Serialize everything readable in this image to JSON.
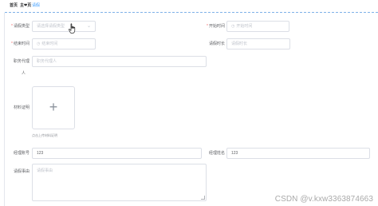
{
  "breadcrumb": {
    "home": "首页",
    "current": "主❤页",
    "active_tab": "请假"
  },
  "form": {
    "leave_type": {
      "label": "请假类型",
      "placeholder": "请选择请假类型"
    },
    "start_time": {
      "label": "开始时间",
      "placeholder": "开始时间"
    },
    "end_time": {
      "label": "结束时间",
      "placeholder": "结束时间"
    },
    "leave_duration": {
      "label": "请假时长",
      "placeholder": "请假时长"
    },
    "delegate": {
      "label": "职务代理",
      "label_wrap": "人",
      "placeholder": "职务代理人"
    },
    "material": {
      "label": "材料证明",
      "tip": "点击上传材料证明"
    },
    "manager_account": {
      "label": "经理账号",
      "value": "123"
    },
    "manager_name": {
      "label": "经理姓名",
      "value": "123"
    },
    "reason": {
      "label": "请假事由",
      "placeholder": "请假事由"
    }
  },
  "icons": {
    "clock": "clock-icon",
    "chevron": "chevron-down-icon",
    "plus": "plus-icon",
    "cursor": "hand-pointer-icon"
  },
  "colors": {
    "required": "#f56c6c",
    "accent": "#409eff",
    "border": "#dcdfe6"
  },
  "watermark": "CSDN @v.kxw3363874663"
}
